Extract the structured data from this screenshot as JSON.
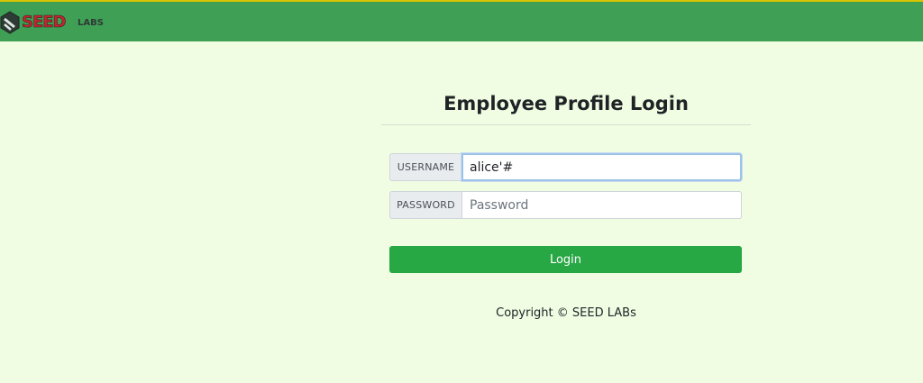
{
  "header": {
    "logo_text": "SEED",
    "logo_sub": "LABS",
    "colors": {
      "bar": "#3f9f55",
      "top_stripe": "#d8c400",
      "logo_red": "#c8232c"
    }
  },
  "login": {
    "title": "Employee Profile Login",
    "username_label": "USERNAME",
    "username_value": "alice'#",
    "password_label": "PASSWORD",
    "password_placeholder": "Password",
    "button_label": "Login",
    "button_color": "#28a745"
  },
  "footer": {
    "copyright": "Copyright © SEED LABs"
  },
  "page": {
    "background": "#f0fde3"
  }
}
